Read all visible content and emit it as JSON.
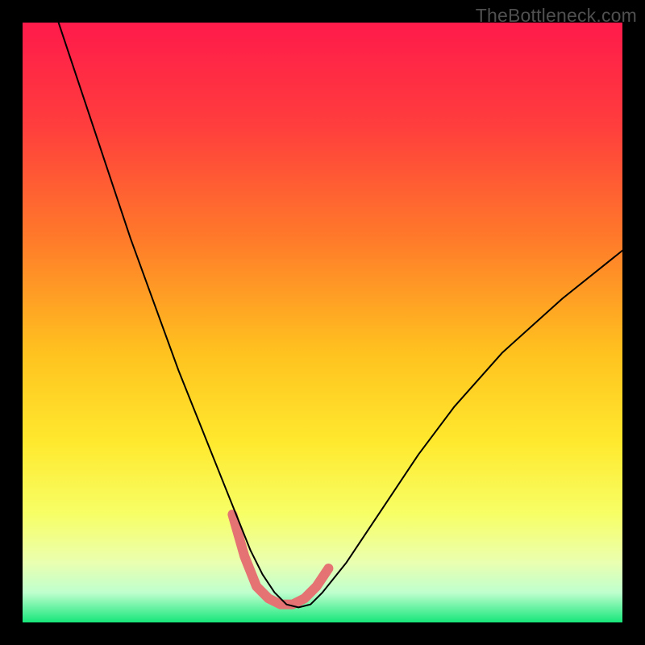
{
  "attribution": "TheBottleneck.com",
  "chart_data": {
    "type": "line",
    "title": "",
    "xlabel": "",
    "ylabel": "",
    "xlim": [
      0,
      100
    ],
    "ylim": [
      0,
      100
    ],
    "gradient_stops": [
      {
        "offset": 0.0,
        "color": "#ff1a4b"
      },
      {
        "offset": 0.17,
        "color": "#ff3d3d"
      },
      {
        "offset": 0.36,
        "color": "#ff7a2a"
      },
      {
        "offset": 0.55,
        "color": "#ffc21f"
      },
      {
        "offset": 0.7,
        "color": "#ffe92e"
      },
      {
        "offset": 0.82,
        "color": "#f7ff66"
      },
      {
        "offset": 0.9,
        "color": "#eaffb0"
      },
      {
        "offset": 0.95,
        "color": "#bfffce"
      },
      {
        "offset": 1.0,
        "color": "#17e67a"
      }
    ],
    "series": [
      {
        "name": "bottleneck-curve",
        "stroke": "#000000",
        "stroke_width": 2,
        "x": [
          6,
          10,
          14,
          18,
          22,
          26,
          30,
          34,
          36,
          38,
          40,
          42,
          44,
          46,
          48,
          50,
          54,
          58,
          62,
          66,
          72,
          80,
          90,
          100
        ],
        "y": [
          100,
          88,
          76,
          64,
          53,
          42,
          32,
          22,
          17,
          12,
          8,
          5,
          3,
          2.5,
          3,
          5,
          10,
          16,
          22,
          28,
          36,
          45,
          54,
          62
        ]
      }
    ],
    "highlight": {
      "name": "optimal-zone",
      "stroke": "#e57373",
      "stroke_width": 12,
      "x": [
        35,
        37,
        39,
        41,
        43,
        45,
        47,
        49,
        51
      ],
      "y": [
        18,
        11,
        6,
        4,
        3,
        3,
        4,
        6,
        9
      ]
    }
  }
}
